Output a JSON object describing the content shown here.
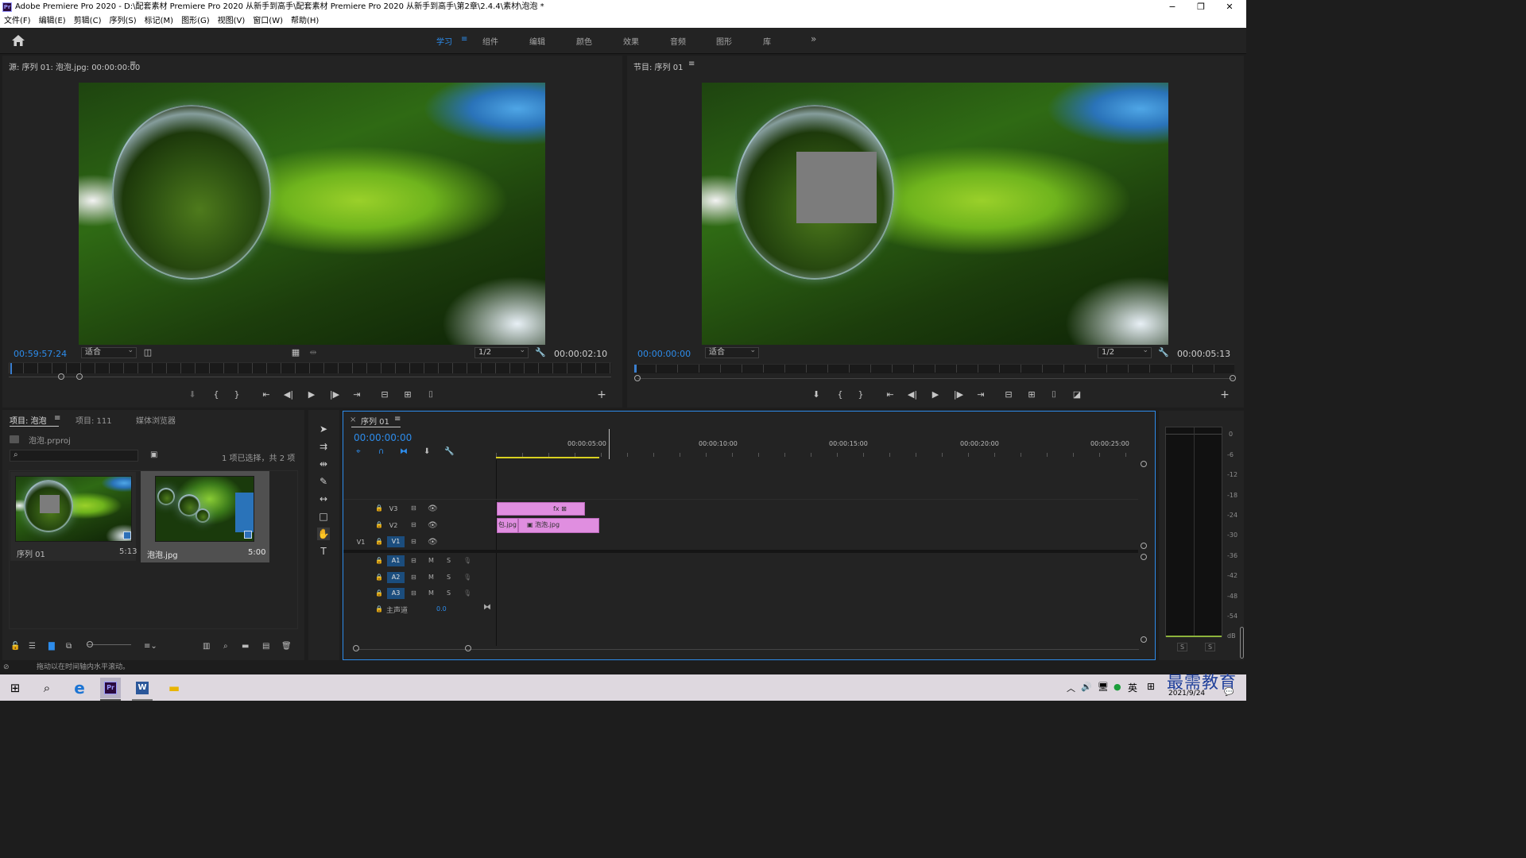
{
  "window": {
    "title": "Adobe Premiere Pro 2020 - D:\\配套素材 Premiere Pro 2020 从新手到高手\\配套素材 Premiere Pro 2020 从新手到高手\\第2章\\2.4.4\\素材\\泡泡 *",
    "app_icon": "Pr",
    "minimize": "−",
    "maximize": "❐",
    "close": "✕"
  },
  "menu": [
    "文件(F)",
    "编辑(E)",
    "剪辑(C)",
    "序列(S)",
    "标记(M)",
    "图形(G)",
    "视图(V)",
    "窗口(W)",
    "帮助(H)"
  ],
  "workspaces": {
    "tabs": [
      "学习",
      "组件",
      "编辑",
      "颜色",
      "效果",
      "音频",
      "图形",
      "库"
    ],
    "active": "学习",
    "more": "»"
  },
  "source_monitor": {
    "title": "源: 序列 01: 泡泡.jpg: 00:00:00:00",
    "timecode": "00:59:57:24",
    "zoom": "适合",
    "resolution": "1/2",
    "duration": "00:00:02:10"
  },
  "program_monitor": {
    "title": "节目: 序列 01",
    "timecode": "00:00:00:00",
    "zoom": "适合",
    "resolution": "1/2",
    "duration": "00:00:05:13"
  },
  "project": {
    "tabs": [
      "项目: 泡泡",
      "项目: 111",
      "媒体浏览器"
    ],
    "file": "泡泡.prproj",
    "selection": "1 项已选择，共 2 项",
    "items": [
      {
        "name": "序列 01",
        "duration": "5:13"
      },
      {
        "name": "泡泡.jpg",
        "duration": "5:00"
      }
    ]
  },
  "timeline": {
    "tab": "序列 01",
    "timecode": "00:00:00:00",
    "ruler": [
      "00:00:05:00",
      "00:00:10:00",
      "00:00:15:00",
      "00:00:20:00",
      "00:00:25:00"
    ],
    "video_tracks": [
      "V3",
      "V2",
      "V1"
    ],
    "source_patch": "V1",
    "audio_tracks": [
      "A1",
      "A2",
      "A3"
    ],
    "mute": "M",
    "solo": "S",
    "master": "主声道",
    "master_value": "0.0",
    "clips": {
      "v3": "fx ⊠",
      "v2_left": "包.jpg",
      "v2_right": "泡泡.jpg"
    }
  },
  "meter": {
    "scale": [
      "0",
      "-6",
      "-12",
      "-18",
      "-24",
      "-30",
      "-36",
      "-42",
      "-48",
      "-54",
      "dB"
    ],
    "solo": "S"
  },
  "status": "拖动以在时间轴内水平滚动。",
  "taskbar": {
    "date": "2021/9/24",
    "lang": "英",
    "watermark": "最需教育"
  },
  "colors": {
    "accent": "#2d8ceb",
    "clip": "#e08ee0",
    "track_active": "#1b4d7d"
  }
}
